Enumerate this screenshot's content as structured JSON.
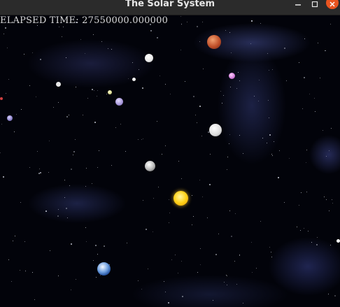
{
  "window": {
    "title": "The Solar System",
    "controls": {
      "minimize_icon": "minimize-icon",
      "maximize_icon": "maximize-icon",
      "close_icon": "close-icon",
      "close_color": "#e95420"
    }
  },
  "hud": {
    "elapsed_label": "ELAPSED TIME: 27550000.000000"
  },
  "bodies": [
    {
      "name": "mars",
      "color": "#c0502a"
    },
    {
      "name": "sun",
      "color": "#ffd21a"
    },
    {
      "name": "earth",
      "color": "#1f4c9a"
    },
    {
      "name": "moon",
      "color": "#d8d8d8"
    },
    {
      "name": "mercury",
      "color": "#bdbdbd"
    }
  ],
  "colors": {
    "background": "#02030a",
    "titlebar": "#2b2b2b",
    "nebula": "#4650a0"
  }
}
